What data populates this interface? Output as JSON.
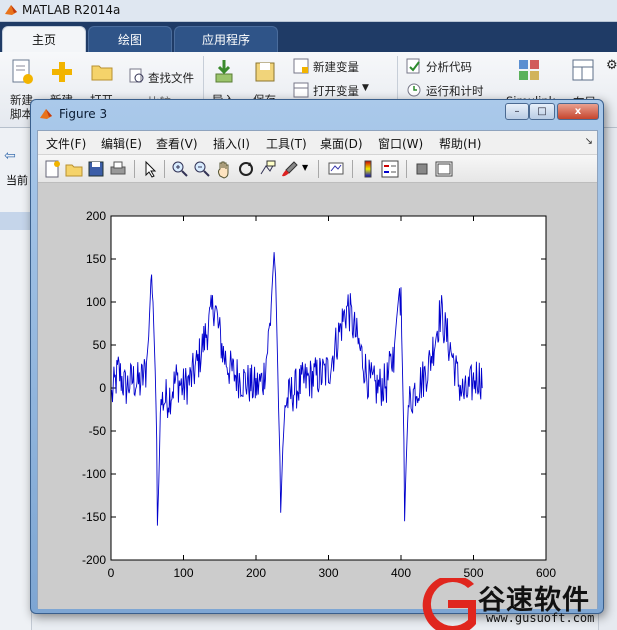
{
  "app": {
    "window_title": "MATLAB R2014a",
    "tabs": [
      {
        "label": "主页",
        "active": true
      },
      {
        "label": "绘图",
        "active": false
      },
      {
        "label": "应用程序",
        "active": false
      }
    ],
    "ribbon": {
      "new_script_label_1": "新建",
      "new_script_label_2": "脚本",
      "new_label": "新建",
      "open_label": "打开",
      "find_files": "查找文件",
      "compare_partial": "比较",
      "import_label": "导入",
      "save_label": "保存",
      "new_variable": "新建变量",
      "open_variable": "打开变量",
      "analyze_code": "分析代码",
      "run_and_time": "运行和计时",
      "simulink_partial": "Simulink",
      "layout_partial": "布局"
    },
    "left_panel_partial": "当前"
  },
  "figure": {
    "title": "Figure 3",
    "window_buttons": {
      "close": "x",
      "maximize": "□",
      "minimize": "–"
    },
    "menu": [
      "文件(F)",
      "编辑(E)",
      "查看(V)",
      "插入(I)",
      "工具(T)",
      "桌面(D)",
      "窗口(W)",
      "帮助(H)"
    ],
    "toolbar_icons": [
      "new-figure-icon",
      "open-file-icon",
      "save-icon",
      "print-icon",
      "pointer-icon",
      "zoom-in-icon",
      "zoom-out-icon",
      "pan-hand-icon",
      "rotate-3d-icon",
      "data-cursor-icon",
      "brush-icon",
      "link-plot-icon",
      "colorbar-icon",
      "legend-icon",
      "hide-plot-tools-icon",
      "show-plot-tools-icon"
    ]
  },
  "chart_data": {
    "type": "line",
    "title": "",
    "xlabel": "",
    "ylabel": "",
    "xlim": [
      0,
      600
    ],
    "ylim": [
      -200,
      200
    ],
    "xticks": [
      0,
      100,
      200,
      300,
      400,
      500,
      600
    ],
    "yticks": [
      -200,
      -150,
      -100,
      -50,
      0,
      50,
      100,
      150,
      200
    ],
    "line_color": "#0000cc",
    "grid": false,
    "n_points": 512,
    "series": [
      {
        "x_start": 1,
        "x_end": 512,
        "key_points": [
          [
            1,
            -10
          ],
          [
            10,
            20
          ],
          [
            20,
            0
          ],
          [
            30,
            10
          ],
          [
            40,
            5
          ],
          [
            48,
            20
          ],
          [
            52,
            60
          ],
          [
            55,
            125
          ],
          [
            57,
            130
          ],
          [
            59,
            70
          ],
          [
            61,
            20
          ],
          [
            63,
            -60
          ],
          [
            64,
            -160
          ],
          [
            66,
            -110
          ],
          [
            68,
            -30
          ],
          [
            70,
            -15
          ],
          [
            80,
            -10
          ],
          [
            90,
            10
          ],
          [
            100,
            0
          ],
          [
            110,
            10
          ],
          [
            120,
            30
          ],
          [
            130,
            60
          ],
          [
            137,
            80
          ],
          [
            143,
            100
          ],
          [
            148,
            70
          ],
          [
            155,
            40
          ],
          [
            165,
            20
          ],
          [
            180,
            10
          ],
          [
            200,
            0
          ],
          [
            210,
            10
          ],
          [
            215,
            40
          ],
          [
            220,
            80
          ],
          [
            223,
            130
          ],
          [
            225,
            158
          ],
          [
            227,
            130
          ],
          [
            229,
            60
          ],
          [
            231,
            -20
          ],
          [
            233,
            -80
          ],
          [
            234,
            -145
          ],
          [
            237,
            -70
          ],
          [
            240,
            -20
          ],
          [
            250,
            -5
          ],
          [
            270,
            10
          ],
          [
            290,
            15
          ],
          [
            300,
            20
          ],
          [
            310,
            50
          ],
          [
            320,
            80
          ],
          [
            327,
            95
          ],
          [
            335,
            70
          ],
          [
            345,
            40
          ],
          [
            355,
            10
          ],
          [
            365,
            0
          ],
          [
            380,
            5
          ],
          [
            390,
            40
          ],
          [
            395,
            90
          ],
          [
            398,
            116
          ],
          [
            400,
            100
          ],
          [
            402,
            20
          ],
          [
            404,
            -60
          ],
          [
            405,
            -155
          ],
          [
            407,
            -90
          ],
          [
            410,
            -20
          ],
          [
            420,
            0
          ],
          [
            430,
            10
          ],
          [
            440,
            30
          ],
          [
            450,
            70
          ],
          [
            455,
            90
          ],
          [
            460,
            70
          ],
          [
            470,
            40
          ],
          [
            480,
            5
          ],
          [
            488,
            -10
          ],
          [
            495,
            0
          ],
          [
            505,
            15
          ],
          [
            512,
            10
          ]
        ]
      }
    ]
  },
  "watermark": {
    "text": "谷速软件",
    "url": "www.gusuoft.com"
  }
}
